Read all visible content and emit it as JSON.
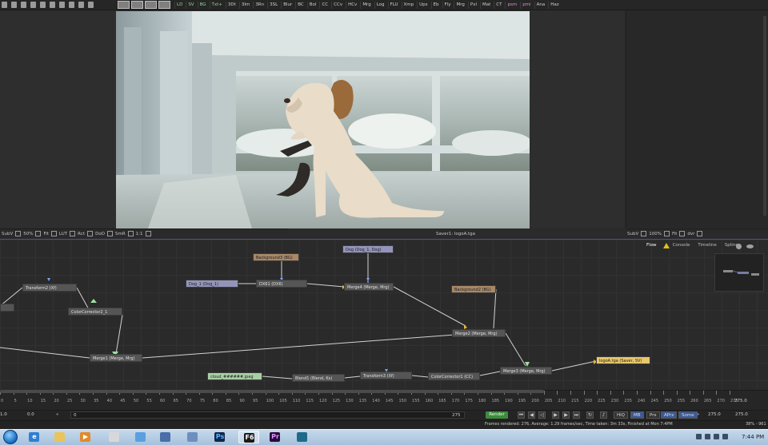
{
  "toolbar": {
    "tools": [
      "LD",
      "SV",
      "BG",
      "Txt+",
      "3Dt",
      "3Im",
      "3Rn",
      "3SL",
      "Blur",
      "BC",
      "Bol",
      "CC",
      "CCv",
      "HCv",
      "Mrg",
      "Log",
      "FLU",
      "Xmp",
      "Ups",
      "Eb",
      "Fly",
      "Mrg",
      "Pxl",
      "Mat",
      "CT",
      "psm",
      "pmi",
      "Ana",
      "Haz"
    ],
    "tool_colors": {
      "LD": "#8fd48f",
      "SV": "#8fd48f",
      "BG": "#8fd48f",
      "Txt+": "#8fd48f",
      "psm": "#e08ad8",
      "pmi": "#e08ad8"
    }
  },
  "left_viewer": {
    "controls": [
      "SubV",
      "50%",
      "Fit",
      "LUT",
      "Rct",
      "DoD",
      "SmR",
      "1:1"
    ]
  },
  "right_viewer": {
    "controls": [
      "SubV",
      "100%",
      "Fit",
      "dvr"
    ]
  },
  "viewer_caption": "Saver1: logoA.tga",
  "flow_tabs": [
    {
      "label": "Flow",
      "active": true
    },
    {
      "label": "Console",
      "active": false
    },
    {
      "label": "Timeline",
      "active": false
    },
    {
      "label": "Spline",
      "active": false
    }
  ],
  "nodes": {
    "transform2": "Transform2 (Xf)",
    "colorcorrector2": "ColorCorrector2_1",
    "merge1": "Merge1 (Merge, Mrg)",
    "dog1": "Dog_1 (Dog_1)",
    "background3": "Background3 (BG)",
    "dxf": "DX61 (DX6)",
    "dog": "Dog (Dog_1, Dog)",
    "merge4": "Merge4 (Merge, Mrg)",
    "background2": "Background2 (BG)",
    "merge2": "Merge2 (Merge, Mrg)",
    "cloud": "cloud_######.jpeg",
    "blend1": "Blend1 (Blend, Ks)",
    "transform3": "Transform3 (Xf)",
    "colorcorrector1": "ColorCorrector1 (CC)",
    "merge3": "Merge3 (Merge, Mrg)",
    "saver": "logoA.tga (Saver, SV)"
  },
  "ruler": {
    "ticks": [
      0,
      5,
      10,
      15,
      20,
      25,
      30,
      35,
      40,
      45,
      50,
      55,
      60,
      65,
      70,
      75,
      80,
      85,
      90,
      95,
      100,
      105,
      110,
      115,
      120,
      125,
      130,
      135,
      140,
      145,
      150,
      155,
      160,
      165,
      170,
      175,
      180,
      185,
      190,
      195,
      200,
      205,
      210,
      215,
      220,
      225,
      230,
      235,
      240,
      245,
      250,
      255,
      260,
      265,
      270,
      275
    ],
    "end_value": "275.0"
  },
  "transport": {
    "start": "1.0",
    "current": "0.0",
    "slider_start": "0",
    "slider_end": "275",
    "render_label": "Render",
    "toggles": [
      "HiQ",
      "MB",
      "Prx",
      "APrx",
      "Some"
    ],
    "global_end": "275.0",
    "render_end": "275.0"
  },
  "status": {
    "text": "Frames rendered: 276, Average: 1.29 frames/sec, Time taken: 3m 33s, Finished at Mon 7:4PM",
    "memory": "38% - 961"
  },
  "taskbar": {
    "apps": [
      {
        "name": "ie",
        "color": "#2f7fd6",
        "label": "e"
      },
      {
        "name": "explorer",
        "color": "#e8c45a",
        "label": ""
      },
      {
        "name": "media-player",
        "color": "#e08a2a",
        "label": "▶"
      },
      {
        "name": "notepad-app",
        "color": "#d8d8d8",
        "label": ""
      },
      {
        "name": "chrome",
        "color": "#5aa0e0",
        "label": ""
      },
      {
        "name": "display",
        "color": "#4a6ea8",
        "label": ""
      },
      {
        "name": "files",
        "color": "#6d8fc0",
        "label": ""
      },
      {
        "name": "photoshop",
        "color": "#13254a",
        "label": "Ps"
      },
      {
        "name": "fusion",
        "color": "#1a1a1a",
        "label": "F6"
      },
      {
        "name": "premiere",
        "color": "#2a0a3a",
        "label": "Pr"
      },
      {
        "name": "maya",
        "color": "#1f6a8a",
        "label": ""
      }
    ],
    "clock": "7:44 PM"
  }
}
